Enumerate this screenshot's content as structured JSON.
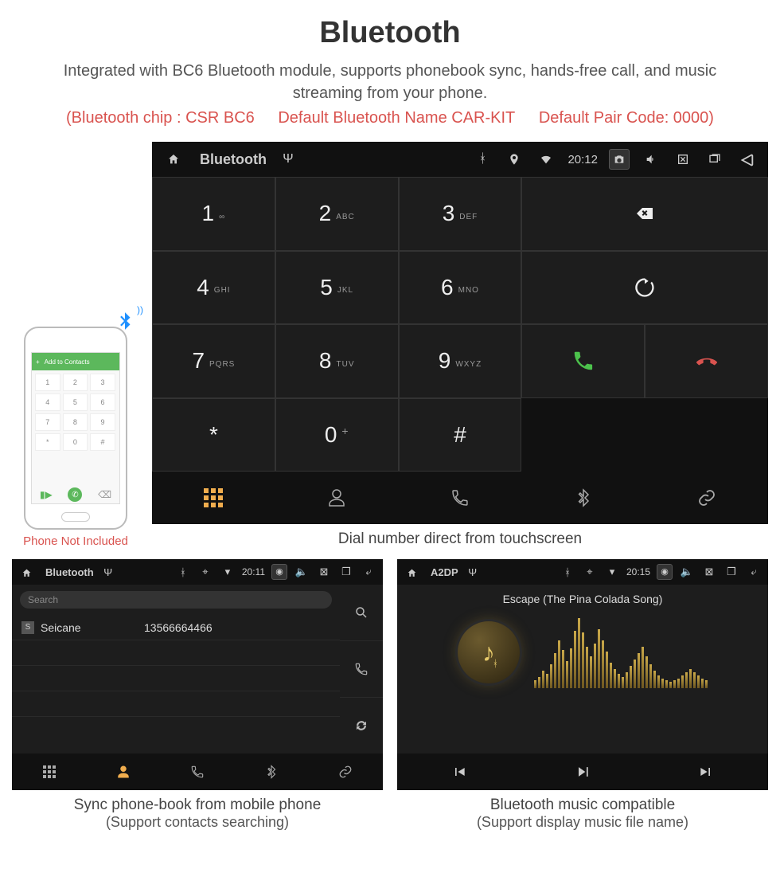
{
  "header": {
    "title": "Bluetooth",
    "description": "Integrated with BC6 Bluetooth module, supports phonebook sync, hands-free call, and music streaming from your phone.",
    "spec_chip": "(Bluetooth chip : CSR BC6",
    "spec_name": "Default Bluetooth Name CAR-KIT",
    "spec_code": "Default Pair Code: 0000)"
  },
  "phone": {
    "add_contacts": "Add to Contacts",
    "caption": "Phone Not Included"
  },
  "dialer": {
    "statusbar": {
      "title": "Bluetooth",
      "time": "20:12"
    },
    "keys": [
      {
        "d": "1",
        "s": "∞"
      },
      {
        "d": "2",
        "s": "ABC"
      },
      {
        "d": "3",
        "s": "DEF"
      },
      {
        "d": "4",
        "s": "GHI"
      },
      {
        "d": "5",
        "s": "JKL"
      },
      {
        "d": "6",
        "s": "MNO"
      },
      {
        "d": "7",
        "s": "PQRS"
      },
      {
        "d": "8",
        "s": "TUV"
      },
      {
        "d": "9",
        "s": "WXYZ"
      },
      {
        "d": "*",
        "s": ""
      },
      {
        "d": "0",
        "s": "+"
      },
      {
        "d": "#",
        "s": ""
      }
    ],
    "caption": "Dial number direct from touchscreen"
  },
  "contacts": {
    "statusbar": {
      "title": "Bluetooth",
      "time": "20:11"
    },
    "search_placeholder": "Search",
    "rows": [
      {
        "badge": "S",
        "name": "Seicane",
        "number": "13566664466"
      }
    ],
    "caption_line1": "Sync phone-book from mobile phone",
    "caption_line2": "(Support contacts searching)"
  },
  "music": {
    "statusbar": {
      "title": "A2DP",
      "time": "20:15"
    },
    "track": "Escape (The Pina Colada Song)",
    "caption_line1": "Bluetooth music compatible",
    "caption_line2": "(Support display music file name)"
  }
}
